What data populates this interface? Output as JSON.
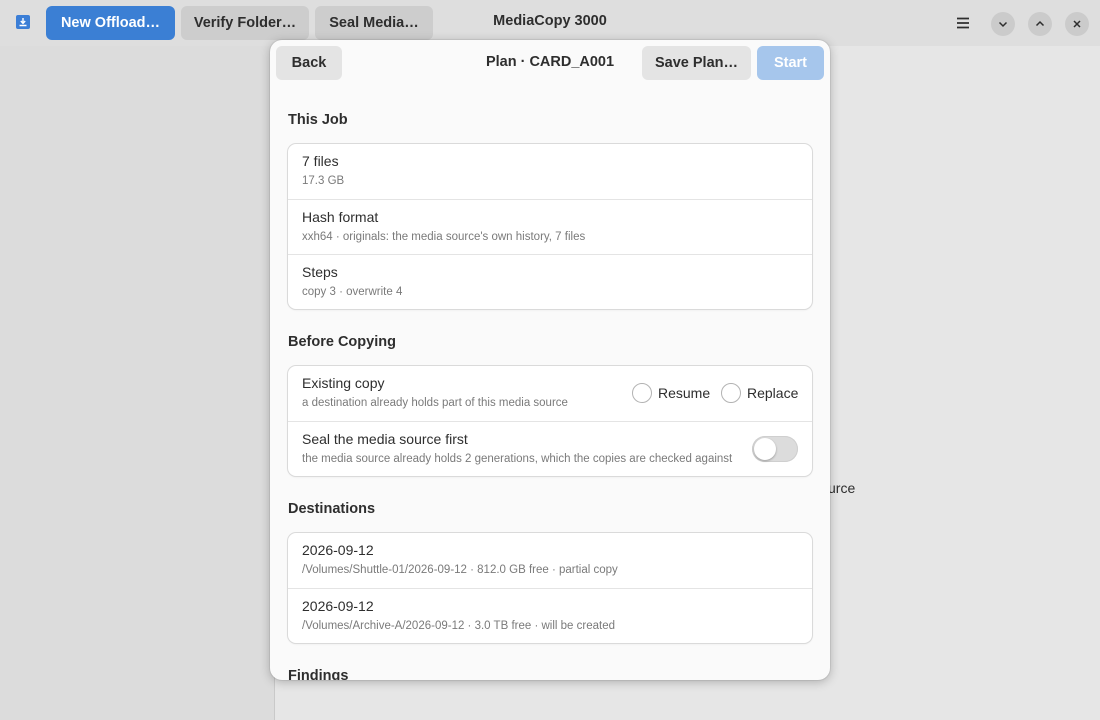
{
  "header": {
    "new_offload_label": "New Offload…",
    "verify_folder_label": "Verify Folder…",
    "seal_media_label": "Seal Media…",
    "window_title": "MediaCopy 3000"
  },
  "background": {
    "fragment_text": "urce"
  },
  "dialog": {
    "back_label": "Back",
    "title": "Plan · CARD_A001",
    "save_plan_label": "Save Plan…",
    "start_label": "Start",
    "this_job": {
      "heading": "This Job",
      "rows": [
        {
          "title": "7 files",
          "subtitle": "17.3 GB"
        },
        {
          "title": "Hash format",
          "subtitle": "xxh64 · originals: the media source's own history, 7 files"
        },
        {
          "title": "Steps",
          "subtitle": "copy 3 · overwrite 4"
        }
      ]
    },
    "before_copying": {
      "heading": "Before Copying",
      "existing_copy": {
        "title": "Existing copy",
        "subtitle": "a destination already holds part of this media source",
        "options": [
          "Resume",
          "Replace"
        ]
      },
      "seal_first": {
        "title": "Seal the media source first",
        "subtitle": "the media source already holds 2 generations, which the copies are checked against",
        "enabled": false
      }
    },
    "destinations": {
      "heading": "Destinations",
      "rows": [
        {
          "title": "2026-09-12",
          "subtitle": "/Volumes/Shuttle-01/2026-09-12 · 812.0 GB free · partial copy"
        },
        {
          "title": "2026-09-12",
          "subtitle": "/Volumes/Archive-A/2026-09-12 · 3.0 TB free · will be created"
        }
      ]
    },
    "findings": {
      "heading": "Findings"
    }
  },
  "colors": {
    "accent": "#3b7fd4",
    "start_disabled": "#a6c6ec"
  }
}
